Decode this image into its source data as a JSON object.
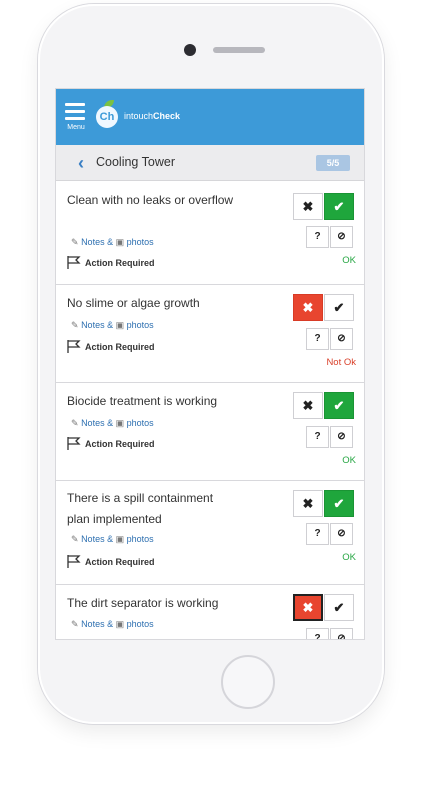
{
  "app": {
    "menu_label": "Menu",
    "logo_mark": "Ch",
    "brand_prefix": "intouch",
    "brand_suffix": "Check"
  },
  "header": {
    "title": "Cooling Tower",
    "counter": "5/5"
  },
  "labels": {
    "notes": "Notes &",
    "photos": "photos",
    "action_required": "Action Required",
    "no_symbol": "✖",
    "yes_symbol": "✔",
    "question_symbol": "?",
    "na_symbol": "⊘"
  },
  "items": [
    {
      "text": "Clean with no leaks or overflow",
      "status": "OK",
      "selected": "yes"
    },
    {
      "text": "No slime or algae growth",
      "status": "Not Ok",
      "selected": "no"
    },
    {
      "text": "Biocide treatment is working",
      "status": "OK",
      "selected": "yes"
    },
    {
      "text": "There is a spill containment plan implemented",
      "status": "OK",
      "selected": "yes"
    },
    {
      "text": "The dirt separator is working",
      "status": "",
      "selected": "no"
    }
  ],
  "colors": {
    "appbar": "#3d9ad8",
    "ok_green": "#1fa63c",
    "not_ok_red": "#e8452f",
    "link_blue": "#2d6fb0"
  }
}
